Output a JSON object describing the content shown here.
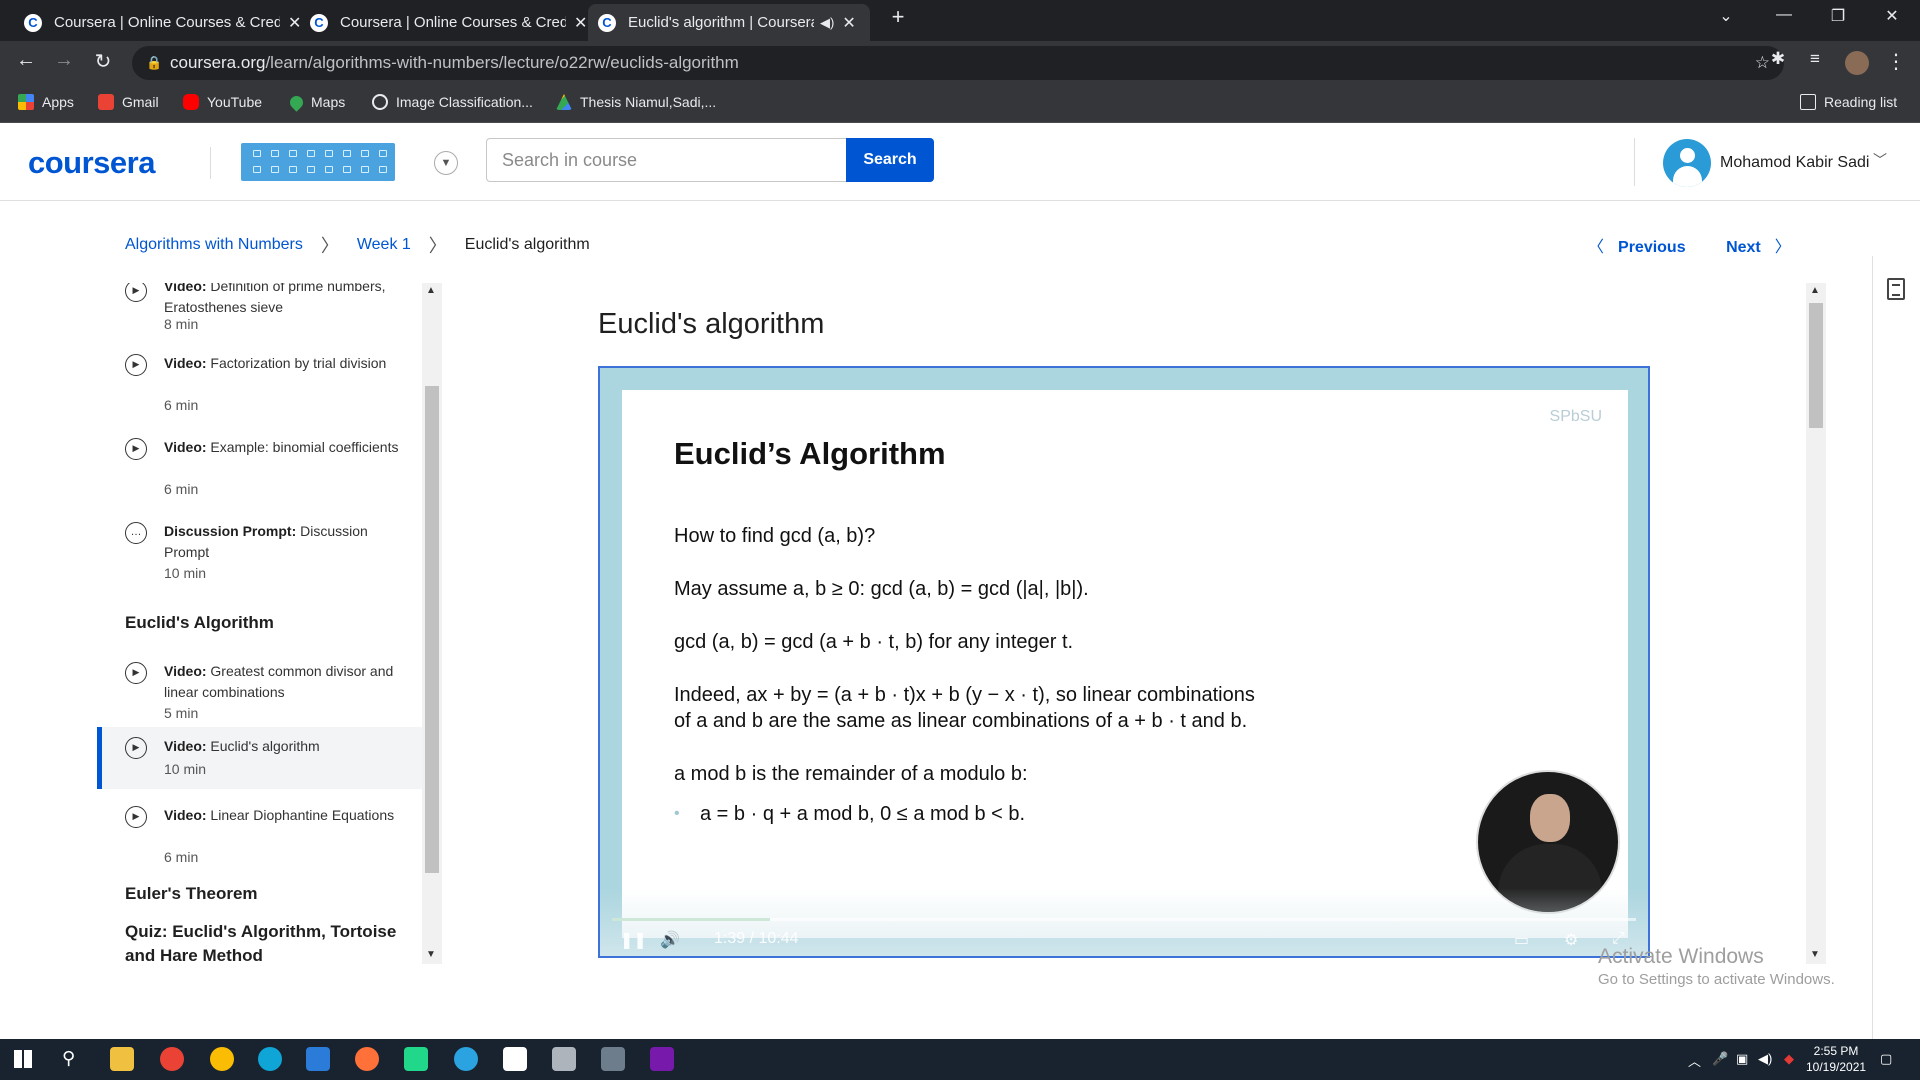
{
  "browser": {
    "tabs": [
      {
        "title": "Coursera | Online Courses & Credentials"
      },
      {
        "title": "Coursera | Online Courses & Credentials"
      },
      {
        "title": "Euclid's algorithm | Coursera"
      }
    ],
    "url_host": "coursera.org",
    "url_path": "/learn/algorithms-with-numbers/lecture/o22rw/euclids-algorithm",
    "bookmarks": [
      {
        "label": "Apps",
        "color": "#e8eaed"
      },
      {
        "label": "Gmail",
        "color": "#ea4335"
      },
      {
        "label": "YouTube",
        "color": "#ff0000"
      },
      {
        "label": "Maps",
        "color": "#34a853"
      },
      {
        "label": "Image Classification...",
        "color": "#e8eaed"
      },
      {
        "label": "Thesis Niamul,Sadi,...",
        "color": "#fbbc04"
      }
    ],
    "reading_list": "Reading list"
  },
  "header": {
    "logo": "coursera",
    "search_placeholder": "Search in course",
    "search_button": "Search",
    "username": "Mohamod Kabir Sadi"
  },
  "breadcrumb": {
    "course": "Algorithms with Numbers",
    "week": "Week 1",
    "current": "Euclid's algorithm"
  },
  "nav": {
    "previous": "Previous",
    "next": "Next"
  },
  "sidebar": {
    "items": [
      {
        "type": "Video:",
        "title": "Definition of prime numbers, Eratosthenes sieve",
        "duration": "8 min"
      },
      {
        "type": "Video:",
        "title": "Factorization by trial division",
        "duration": "6 min"
      },
      {
        "type": "Video:",
        "title": "Example: binomial coefficients",
        "duration": "6 min"
      },
      {
        "type": "Discussion Prompt:",
        "title": "Discussion Prompt",
        "duration": "10 min"
      },
      {
        "type": "Video:",
        "title": "Greatest common divisor and linear combinations",
        "duration": "5 min"
      },
      {
        "type": "Video:",
        "title": "Euclid's algorithm",
        "duration": "10 min"
      },
      {
        "type": "Video:",
        "title": "Linear Diophantine Equations",
        "duration": "6 min"
      }
    ],
    "section_euclid": "Euclid's Algorithm",
    "section_euler": "Euler's Theorem",
    "section_quiz": "Quiz: Euclid's Algorithm, Tortoise and Hare Method"
  },
  "lecture": {
    "title": "Euclid's algorithm",
    "slide": {
      "logo": "SPbSU",
      "title": "Euclid’s Algorithm",
      "line1": "How to find gcd (a, b)?",
      "line2": "May assume a, b ≥ 0: gcd (a, b) = gcd (|a|, |b|).",
      "line3": "gcd (a, b) = gcd (a + b · t, b) for any integer t.",
      "line4a": "Indeed, ax + by = (a + b · t)x + b (y − x · t), so linear combinations",
      "line4b": "of a and b are the same as linear combinations of a + b · t and b.",
      "line5": "a mod b is the remainder of a modulo b:",
      "line6": "a = b · q + a mod b, 0 ≤ a mod b < b."
    },
    "player": {
      "current_time": "1:39",
      "duration": "10:44",
      "progress": 0.154
    }
  },
  "watermark": {
    "line1": "Activate Windows",
    "line2": "Go to Settings to activate Windows."
  },
  "taskbar": {
    "time": "2:55 PM",
    "date": "10/19/2021"
  }
}
